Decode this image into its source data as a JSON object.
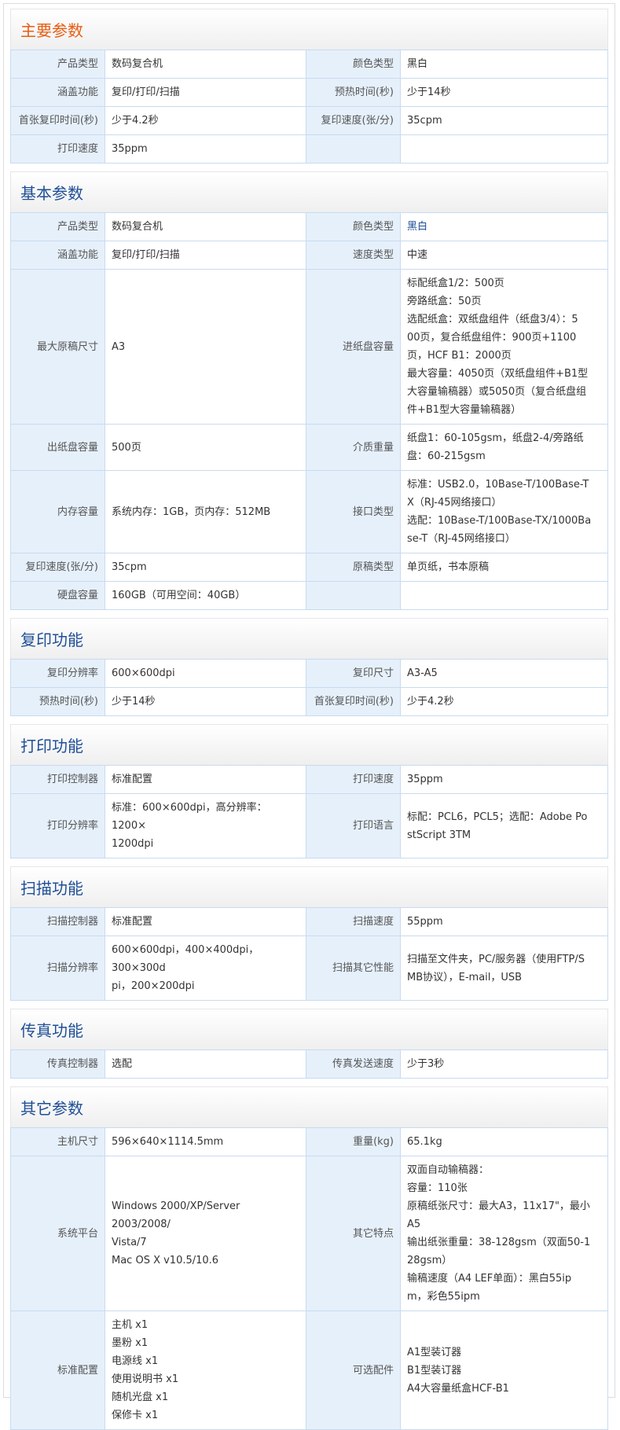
{
  "sections": [
    {
      "title": "主要参数",
      "rows": [
        {
          "l1": "产品类型",
          "v1": [
            "数码复合机"
          ],
          "l2": "颜色类型",
          "v2": [
            "黑白"
          ]
        },
        {
          "l1": "涵盖功能",
          "v1": [
            "复印/打印/扫描"
          ],
          "l2": "预热时间(秒)",
          "v2": [
            "少于14秒"
          ]
        },
        {
          "l1": "首张复印时间(秒)",
          "v1": [
            "少于4.2秒"
          ],
          "l2": "复印速度(张/分)",
          "v2": [
            "35cpm"
          ]
        },
        {
          "l1": "打印速度",
          "v1": [
            "35ppm"
          ],
          "l2": "",
          "v2": []
        }
      ]
    },
    {
      "title": "基本参数",
      "rows": [
        {
          "l1": "产品类型",
          "v1": [
            "数码复合机"
          ],
          "l2": "颜色类型",
          "v2": [
            "黑白"
          ]
        },
        {
          "l1": "涵盖功能",
          "v1": [
            "复印/打印/扫描"
          ],
          "l2": "速度类型",
          "v2": [
            "中速"
          ]
        },
        {
          "l1": "最大原稿尺寸",
          "v1": [
            "A3"
          ],
          "l2": "进纸盘容量",
          "v2": [
            "标配纸盒1/2：500页",
            "旁路纸盒：50页",
            "选配纸盒：双纸盘组件（纸盘3/4）：5",
            "00页，复合纸盘组件：900页+1100",
            "页，HCF B1：2000页",
            "最大容量：4050页（双纸盘组件+B1型",
            "大容量输稿器）或5050页（复合纸盘组",
            "件+B1型大容量输稿器）"
          ]
        },
        {
          "l1": "出纸盘容量",
          "v1": [
            "500页"
          ],
          "l2": "介质重量",
          "v2": [
            "纸盘1：60-105gsm，纸盘2-4/旁路纸",
            "盘：60-215gsm"
          ]
        },
        {
          "l1": "内存容量",
          "v1": [
            "系统内存：1GB，页内存：512MB"
          ],
          "l2": "接口类型",
          "v2": [
            "标准：USB2.0，10Base-T/100Base-T",
            "X（RJ-45网络接口）",
            "选配：10Base-T/100Base-TX/1000Ba",
            "se-T（RJ-45网络接口）"
          ]
        },
        {
          "l1": "复印速度(张/分)",
          "v1": [
            "35cpm"
          ],
          "l2": "原稿类型",
          "v2": [
            "单页纸，书本原稿"
          ]
        },
        {
          "l1": "硬盘容量",
          "v1": [
            "160GB（可用空间：40GB）"
          ],
          "l2": "",
          "v2": []
        }
      ]
    },
    {
      "title": "复印功能",
      "rows": [
        {
          "l1": "复印分辨率",
          "v1": [
            "600×600dpi"
          ],
          "l2": "复印尺寸",
          "v2": [
            "A3-A5"
          ]
        },
        {
          "l1": "预热时间(秒)",
          "v1": [
            "少于14秒"
          ],
          "l2": "首张复印时间(秒)",
          "v2": [
            "少于4.2秒"
          ]
        }
      ]
    },
    {
      "title": "打印功能",
      "rows": [
        {
          "l1": "打印控制器",
          "v1": [
            "标准配置"
          ],
          "l2": "打印速度",
          "v2": [
            "35ppm"
          ]
        },
        {
          "l1": "打印分辨率",
          "v1": [
            "标准：600×600dpi，高分辨率：1200×",
            "1200dpi"
          ],
          "l2": "打印语言",
          "v2": [
            "标配：PCL6，PCL5；选配：Adobe Po",
            "stScript 3TM"
          ]
        }
      ]
    },
    {
      "title": "扫描功能",
      "rows": [
        {
          "l1": "扫描控制器",
          "v1": [
            "标准配置"
          ],
          "l2": "扫描速度",
          "v2": [
            "55ppm"
          ]
        },
        {
          "l1": "扫描分辨率",
          "v1": [
            "600×600dpi，400×400dpi，300×300d",
            "pi，200×200dpi"
          ],
          "l2": "扫描其它性能",
          "v2": [
            "扫描至文件夹，PC/服务器（使用FTP/S",
            "MB协议），E-mail，USB"
          ]
        }
      ]
    },
    {
      "title": "传真功能",
      "rows": [
        {
          "l1": "传真控制器",
          "v1": [
            "选配"
          ],
          "l2": "传真发送速度",
          "v2": [
            "少于3秒"
          ]
        }
      ]
    },
    {
      "title": "其它参数",
      "rows": [
        {
          "l1": "主机尺寸",
          "v1": [
            "596×640×1114.5mm"
          ],
          "l2": "重量(kg)",
          "v2": [
            "65.1kg"
          ]
        },
        {
          "l1": "系统平台",
          "v1": [
            "Windows 2000/XP/Server 2003/2008/",
            "Vista/7",
            "Mac OS X v10.5/10.6"
          ],
          "l2": "其它特点",
          "v2": [
            "双面自动输稿器：",
            "容量：110张",
            "原稿纸张尺寸：最大A3，11x17\"，最小",
            "A5",
            "输出纸张重量：38-128gsm（双面50-1",
            "28gsm）",
            "输稿速度（A4 LEF单面）：黑白55ip",
            "m，彩色55ipm"
          ]
        },
        {
          "l1": "标准配置",
          "v1": [
            "主机 x1",
            "墨粉 x1",
            "电源线 x1",
            "使用说明书 x1",
            "随机光盘 x1",
            "保修卡 x1"
          ],
          "l2": "可选配件",
          "v2": [
            "A1型装订器",
            "B1型装订器",
            "A4大容量纸盒HCF-B1"
          ]
        }
      ]
    }
  ]
}
